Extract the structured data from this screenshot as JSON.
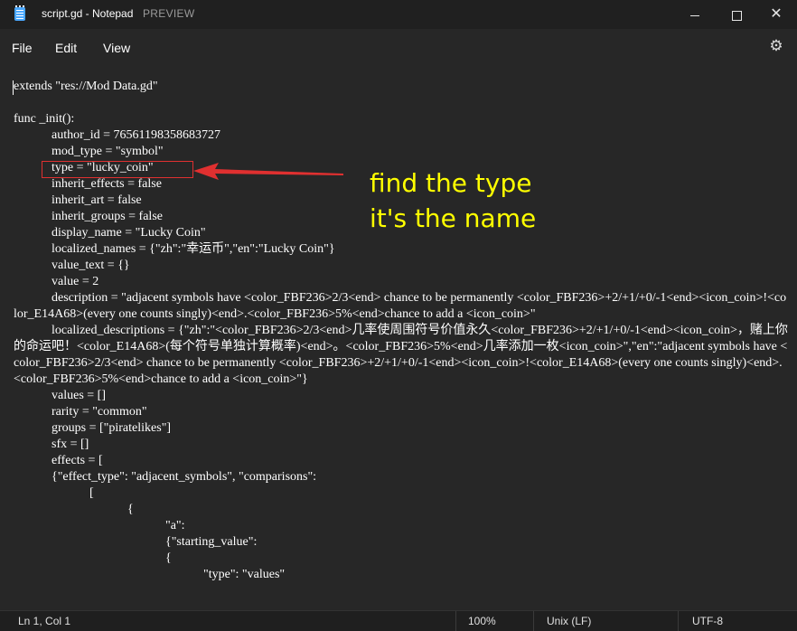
{
  "window": {
    "title": "script.gd - Notepad",
    "preview_label": "PREVIEW",
    "minimize_glyph": "",
    "close_glyph": "✕"
  },
  "menu": {
    "file": "File",
    "edit": "Edit",
    "view": "View",
    "settings_icon": "⚙"
  },
  "editor": {
    "content": "extends \"res://Mod Data.gd\"\n\nfunc _init():\n            author_id = 76561198358683727\n            mod_type = \"symbol\"\n            type = \"lucky_coin\"\n            inherit_effects = false\n            inherit_art = false\n            inherit_groups = false\n            display_name = \"Lucky Coin\"\n            localized_names = {\"zh\":\"幸运币\",\"en\":\"Lucky Coin\"}\n            value_text = {}\n            value = 2\n            description = \"adjacent symbols have <color_FBF236>2/3<end> chance to be permanently <color_FBF236>+2/+1/+0/-1<end><icon_coin>!<color_E14A68>(every one counts singly)<end>.<color_FBF236>5%<end>chance to add a <icon_coin>\"\n            localized_descriptions = {\"zh\":\"<color_FBF236>2/3<end>几率使周围符号价值永久<color_FBF236>+2/+1/+0/-1<end><icon_coin>，赌上你的命运吧！<color_E14A68>(每个符号单独计算概率)<end>。<color_FBF236>5%<end>几率添加一枚<icon_coin>\",\"en\":\"adjacent symbols have <color_FBF236>2/3<end> chance to be permanently <color_FBF236>+2/+1/+0/-1<end><icon_coin>!<color_E14A68>(every one counts singly)<end>.<color_FBF236>5%<end>chance to add a <icon_coin>\"}\n            values = []\n            rarity = \"common\"\n            groups = [\"piratelikes\"]\n            sfx = []\n            effects = [\n            {\"effect_type\": \"adjacent_symbols\", \"comparisons\":\n                        [\n                                    {\n                                                \"a\":\n                                                {\"starting_value\":\n                                                {\n                                                            \"type\": \"values\""
  },
  "annotation": {
    "line1": "find the type",
    "line2": "it's the name",
    "color": "#ffff00",
    "box_color": "#e03030"
  },
  "status": {
    "position": "Ln 1, Col 1",
    "zoom": "100%",
    "line_ending": "Unix (LF)",
    "encoding": "UTF-8"
  }
}
